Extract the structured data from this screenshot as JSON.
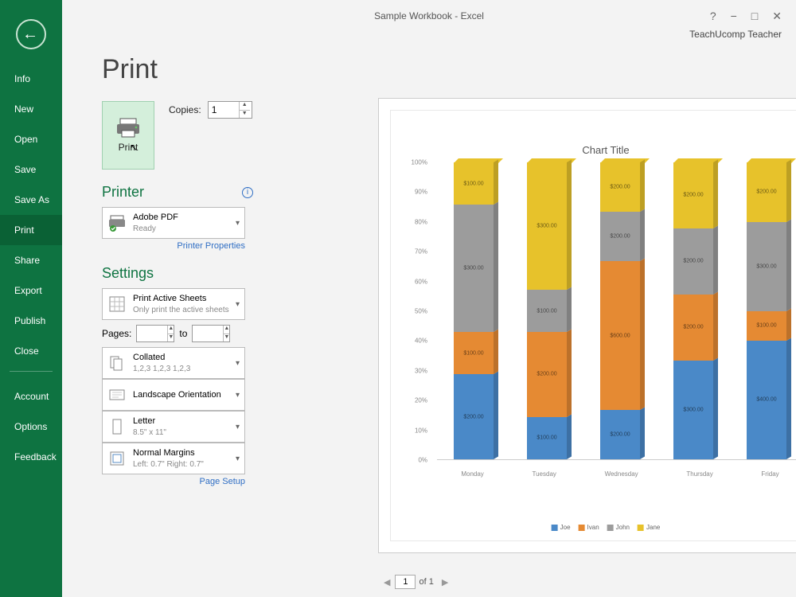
{
  "window": {
    "title": "Sample Workbook - Excel",
    "user": "TeachUcomp Teacher"
  },
  "sidebar": {
    "items": [
      "Info",
      "New",
      "Open",
      "Save",
      "Save As",
      "Print",
      "Share",
      "Export",
      "Publish",
      "Close"
    ],
    "bottom": [
      "Account",
      "Options",
      "Feedback"
    ],
    "selected_index": 5
  },
  "page": {
    "title": "Print"
  },
  "print_button": {
    "label": "Print"
  },
  "copies": {
    "label": "Copies:",
    "value": "1"
  },
  "printer": {
    "heading": "Printer",
    "name": "Adobe PDF",
    "status": "Ready",
    "properties_link": "Printer Properties"
  },
  "settings": {
    "heading": "Settings",
    "print_what": {
      "title": "Print Active Sheets",
      "sub": "Only print the active sheets"
    },
    "pages_label": "Pages:",
    "pages_to": "to",
    "collate": {
      "title": "Collated",
      "sub": "1,2,3    1,2,3    1,2,3"
    },
    "orientation": {
      "title": "Landscape Orientation"
    },
    "paper": {
      "title": "Letter",
      "sub": "8.5\" x 11\""
    },
    "margins": {
      "title": "Normal Margins",
      "sub": "Left: 0.7\"   Right: 0.7\""
    },
    "page_setup_link": "Page Setup"
  },
  "pager": {
    "current": "1",
    "of_label": "of 1"
  },
  "chart_data": {
    "type": "bar",
    "title": "Chart Title",
    "stack_mode": "percent",
    "categories": [
      "Monday",
      "Tuesday",
      "Wednesday",
      "Thursday",
      "Friday"
    ],
    "ylabel": "",
    "yticks": [
      "0%",
      "10%",
      "20%",
      "30%",
      "40%",
      "50%",
      "60%",
      "70%",
      "80%",
      "90%",
      "100%"
    ],
    "series": [
      {
        "name": "Joe",
        "color": "#4a89c8",
        "values": [
          200.0,
          100.0,
          200.0,
          300.0,
          400.0
        ]
      },
      {
        "name": "Ivan",
        "color": "#e58a33",
        "values": [
          100.0,
          200.0,
          600.0,
          200.0,
          100.0
        ]
      },
      {
        "name": "John",
        "color": "#9c9c9c",
        "values": [
          300.0,
          100.0,
          200.0,
          200.0,
          300.0
        ]
      },
      {
        "name": "Jane",
        "color": "#e7c22b",
        "values": [
          100.0,
          300.0,
          200.0,
          200.0,
          200.0
        ]
      }
    ]
  }
}
